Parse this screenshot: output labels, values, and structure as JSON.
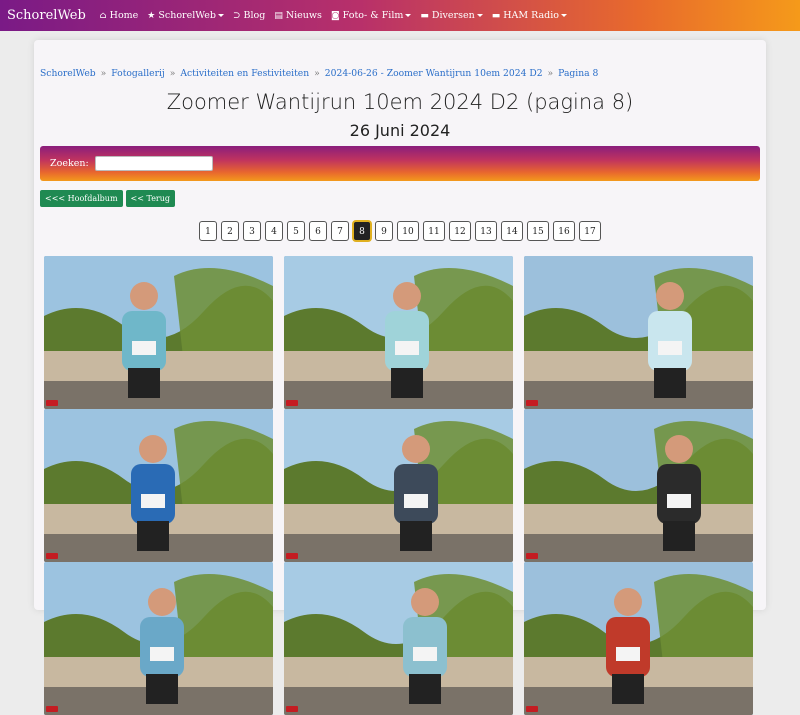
{
  "nav": {
    "brand": "SchorelWeb",
    "items": [
      {
        "label": "Home",
        "icon": "home-icon",
        "glyph": "⌂",
        "dropdown": false
      },
      {
        "label": "SchorelWeb",
        "icon": "star-icon",
        "glyph": "★",
        "dropdown": true
      },
      {
        "label": "Blog",
        "icon": "rss-icon",
        "glyph": "⊃",
        "dropdown": false
      },
      {
        "label": "Nieuws",
        "icon": "newspaper-icon",
        "glyph": "▤",
        "dropdown": false
      },
      {
        "label": "Foto- & Film",
        "icon": "camera-icon",
        "glyph": "◙",
        "dropdown": true
      },
      {
        "label": "Diversen",
        "icon": "folder-icon",
        "glyph": "▬",
        "dropdown": true
      },
      {
        "label": "HAM Radio",
        "icon": "folder-icon",
        "glyph": "▬",
        "dropdown": true
      }
    ]
  },
  "breadcrumb": [
    "SchorelWeb",
    "Fotogallerij",
    "Activiteiten en Festiviteiten",
    "2024-06-26 - Zoomer Wantijrun 10em 2024 D2",
    "Pagina 8"
  ],
  "page": {
    "title": "Zoomer Wantijrun 10em 2024 D2 (pagina 8)",
    "date": "26 Juni 2024"
  },
  "search": {
    "label": "Zoeken:",
    "value": ""
  },
  "buttons": {
    "main_album": "<<< Hoofdalbum",
    "back": "<< Terug"
  },
  "pagination": {
    "pages": [
      "1",
      "2",
      "3",
      "4",
      "5",
      "6",
      "7",
      "8",
      "9",
      "10",
      "11",
      "12",
      "13",
      "14",
      "15",
      "16",
      "17"
    ],
    "current": "8"
  },
  "colors": {
    "nav_gradient_start": "#7a1a86",
    "nav_gradient_end": "#f59a1a",
    "link": "#2a6ec9",
    "button": "#1f8a52"
  }
}
